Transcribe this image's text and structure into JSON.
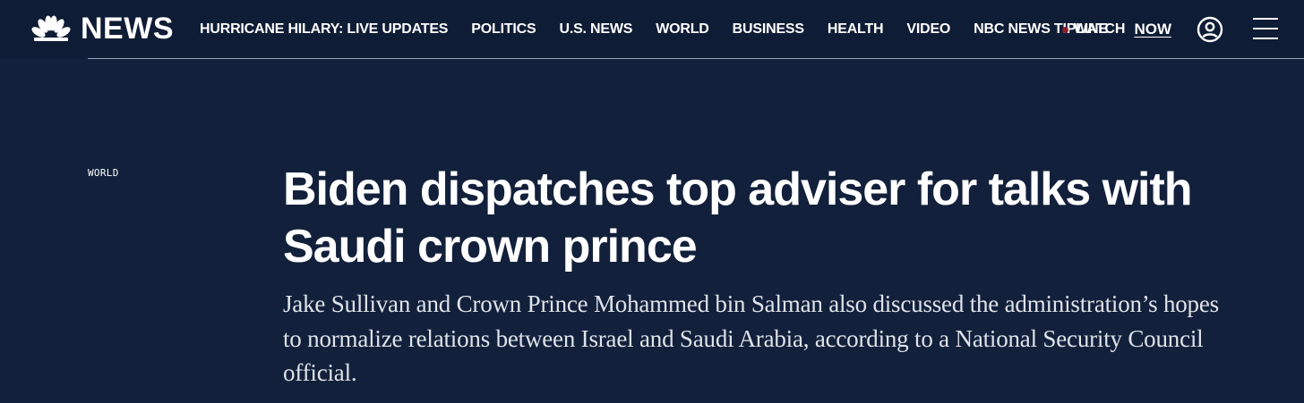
{
  "header": {
    "logo_text": "NEWS",
    "logo_icon": "nbc-peacock-icon",
    "nav_items": [
      {
        "label": "HURRICANE HILARY: LIVE UPDATES"
      },
      {
        "label": "POLITICS"
      },
      {
        "label": "U.S. NEWS"
      },
      {
        "label": "WORLD"
      },
      {
        "label": "BUSINESS"
      },
      {
        "label": "HEALTH"
      },
      {
        "label": "VIDEO"
      },
      {
        "label": "NBC NEWS TIPLINE"
      }
    ],
    "watch_label": "WATCH",
    "watch_now": "NOW",
    "account_icon": "user-account-icon",
    "menu_icon": "hamburger-menu-icon"
  },
  "article": {
    "section": "WORLD",
    "headline": "Biden dispatches top adviser for talks with Saudi crown prince",
    "dek": "Jake Sullivan and Crown Prince Mohammed bin Salman also discussed the administration’s hopes to normalize relations between Israel and Saudi Arabia, according to a National Security Council official."
  },
  "colors": {
    "page_background": "#12203b",
    "header_background": "#0f1c35",
    "live_dot": "#8a1b2c",
    "text": "#ffffff"
  }
}
